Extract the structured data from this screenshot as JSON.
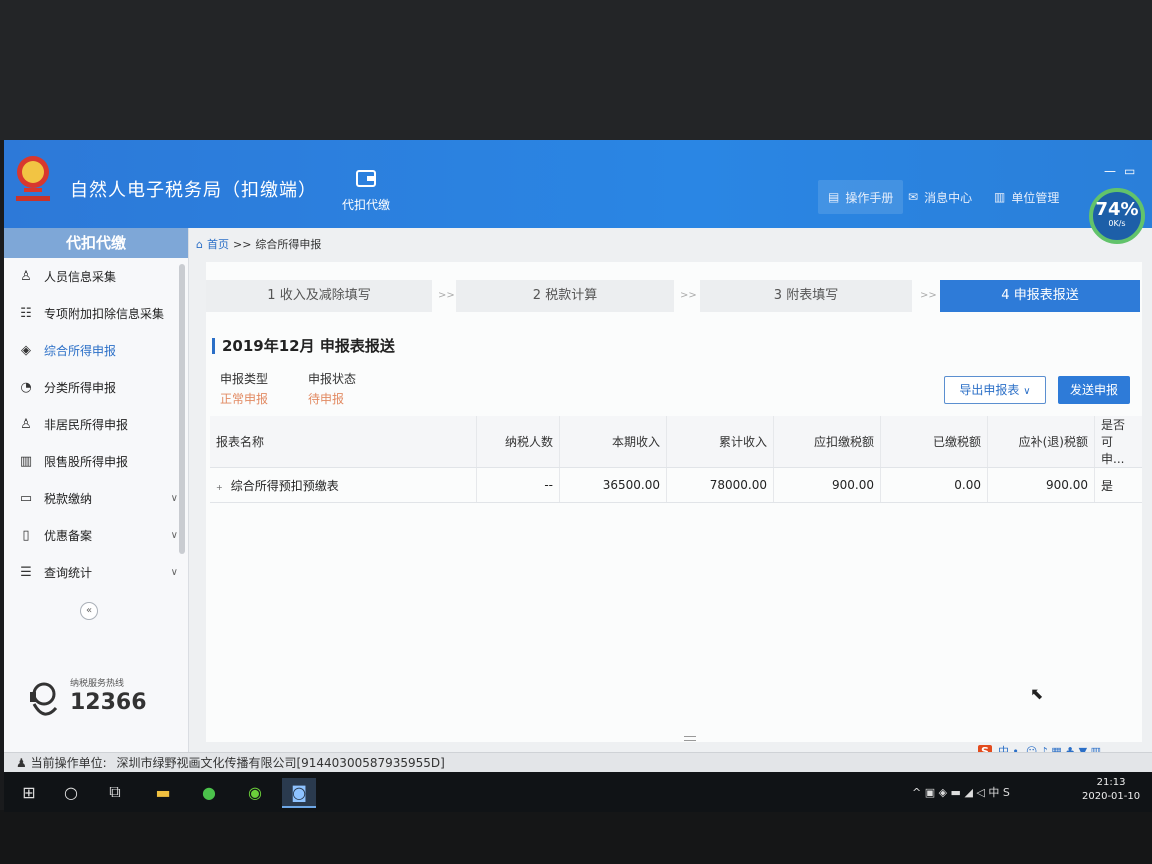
{
  "app": {
    "title": "自然人电子税务局（扣缴端）",
    "nav_label": "代扣代缴",
    "header_buttons": [
      "操作手册",
      "消息中心",
      "单位管理"
    ],
    "gauge_pct": "74%",
    "gauge_speed": "0K/s",
    "win_min": "—",
    "win_restore": "▭"
  },
  "sidebar": {
    "title": "代扣代缴",
    "items": [
      {
        "label": "人员信息采集",
        "icon": "person-icon"
      },
      {
        "label": "专项附加扣除信息采集",
        "icon": "list-icon"
      },
      {
        "label": "综合所得申报",
        "icon": "layers-icon"
      },
      {
        "label": "分类所得申报",
        "icon": "pie-icon"
      },
      {
        "label": "非居民所得申报",
        "icon": "person-outline-icon"
      },
      {
        "label": "限售股所得申报",
        "icon": "bar-icon"
      },
      {
        "label": "税款缴纳",
        "icon": "wallet-icon"
      },
      {
        "label": "优惠备案",
        "icon": "doc-icon"
      },
      {
        "label": "查询统计",
        "icon": "search-list-icon"
      }
    ],
    "collapse": "«",
    "hotline_label": "纳税服务热线",
    "hotline_number": "12366"
  },
  "breadcrumb": {
    "home": "首页",
    "sep": ">>",
    "current": "综合所得申报"
  },
  "steps": [
    {
      "label": "1 收入及减除填写"
    },
    {
      "label": "2 税款计算"
    },
    {
      "label": "3 附表填写"
    },
    {
      "label": "4 申报表报送"
    }
  ],
  "step_arrow": ">>",
  "section": {
    "title": "2019年12月  申报表报送",
    "type_label": "申报类型",
    "type_value": "正常申报",
    "status_label": "申报状态",
    "status_value": "待申报",
    "export_btn": "导出申报表",
    "send_btn": "发送申报"
  },
  "table": {
    "headers": [
      "报表名称",
      "纳税人数",
      "本期收入",
      "累计收入",
      "应扣缴税额",
      "已缴税额",
      "应补(退)税额",
      "是否可申..."
    ],
    "rows": [
      [
        "综合所得预扣预缴表",
        "--",
        "36500.00",
        "78000.00",
        "900.00",
        "0.00",
        "900.00",
        "是"
      ]
    ]
  },
  "status_bar": {
    "label": "当前操作单位:",
    "value": "深圳市绿野视画文化传播有限公司[91440300587935955D]"
  },
  "ime": {
    "s": "S",
    "text": "中 •, ☺ ♪ ▦ ♣ ▼ ▥"
  },
  "tray": {
    "icons": "^ ▣ ◈ ▬ ◢ ◁ 中 S"
  },
  "clock": {
    "time": "21:13",
    "date": "2020-01-10"
  }
}
